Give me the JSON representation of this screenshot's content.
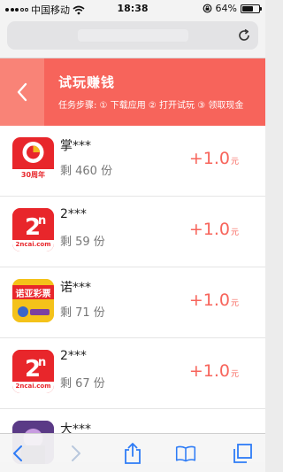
{
  "status_bar": {
    "carrier": "中国移动",
    "time": "18:38",
    "battery_text": "64%",
    "battery_level": 0.64,
    "icons": [
      "signal-icon",
      "wifi-icon",
      "orientation-lock-icon",
      "battery-icon"
    ]
  },
  "url_bar": {
    "url_text": "",
    "reload_icon": "reload-icon"
  },
  "header": {
    "back_icon": "chevron-left-icon",
    "title": "试玩赚钱",
    "steps": "任务步骤: ① 下载应用 ② 打开试玩 ③ 领取现金"
  },
  "items": [
    {
      "name": "掌***",
      "remain": "剩 460 份",
      "amount": "+1.0",
      "unit": "元",
      "icon": "zhang-app-icon",
      "icon_label": "30周年"
    },
    {
      "name": "2***",
      "remain": "剩 59 份",
      "amount": "+1.0",
      "unit": "元",
      "icon": "2ncai-app-icon",
      "icon_label": "2ncai.com"
    },
    {
      "name": "诺***",
      "remain": "剩 71 份",
      "amount": "+1.0",
      "unit": "元",
      "icon": "nuoya-app-icon",
      "icon_label": "诺亚彩票"
    },
    {
      "name": "2***",
      "remain": "剩 67 份",
      "amount": "+1.0",
      "unit": "元",
      "icon": "2ncai-app-icon",
      "icon_label": "2ncai.com"
    },
    {
      "name": "大***",
      "remain": "",
      "amount": "",
      "unit": "",
      "icon": "da-app-icon",
      "icon_label": ""
    }
  ],
  "toolbar": {
    "icons": [
      "back-arrow-icon",
      "forward-arrow-icon",
      "share-icon",
      "bookmarks-icon",
      "tabs-icon"
    ]
  },
  "colors": {
    "header": "#f7645b",
    "header_back": "#f98377",
    "reward": "#f7645b"
  }
}
